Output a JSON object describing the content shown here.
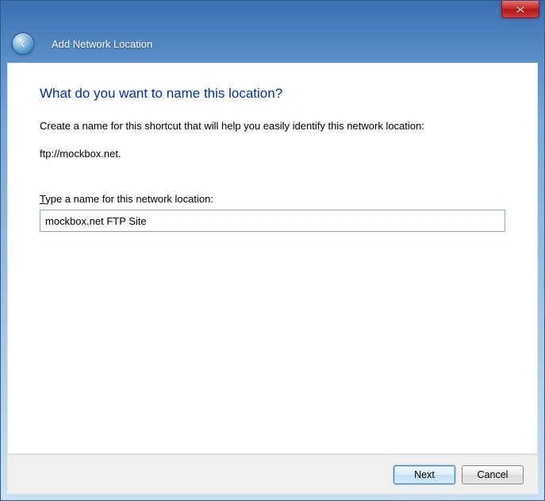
{
  "wizard": {
    "title": "Add Network Location",
    "heading": "What do you want to name this location?",
    "instruction": "Create a name for this shortcut that will help you easily identify this network location:",
    "url": "ftp://mockbox.net.",
    "field_label_prefix": "T",
    "field_label_rest": "ype a name for this network location:",
    "name_value": "mockbox.net FTP Site"
  },
  "buttons": {
    "next": "Next",
    "cancel": "Cancel"
  }
}
